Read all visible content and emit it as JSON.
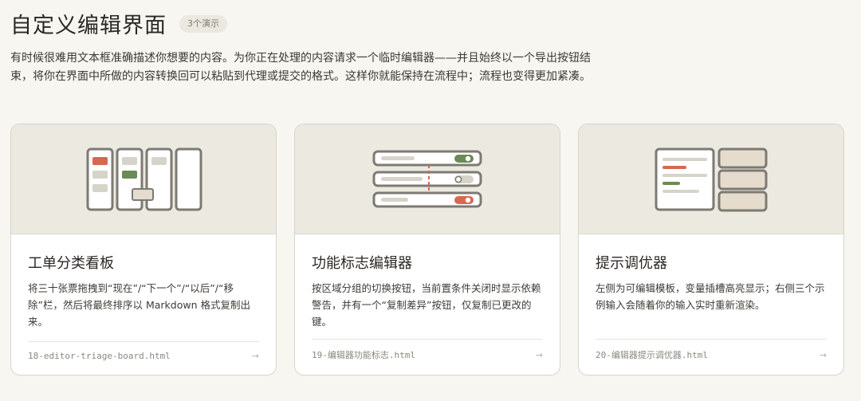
{
  "header": {
    "title": "自定义编辑界面",
    "badge": "3个演示"
  },
  "intro": "有时候很难用文本框准确描述你想要的内容。为你正在处理的内容请求一个临时编辑器——并且始终以一个导出按钮结束，将你在界面中所做的内容转换回可以粘贴到代理或提交的格式。这样你就能保持在流程中；流程也变得更加紧凑。",
  "cards": [
    {
      "title": "工单分类看板",
      "description": "将三十张票拖拽到“现在”/“下一个”/“以后”/“移除”栏，然后将最终排序以 Markdown 格式复制出来。",
      "file": "18-editor-triage-board.html",
      "arrow": "→",
      "icon": "kanban-board-icon"
    },
    {
      "title": "功能标志编辑器",
      "description": "按区域分组的切换按钮，当前置条件关闭时显示依赖警告，并有一个“复制差异”按钮，仅复制已更改的键。",
      "file": "19-编辑器功能标志.html",
      "arrow": "→",
      "icon": "toggle-list-icon"
    },
    {
      "title": "提示调优器",
      "description": "左侧为可编辑模板，变量插槽高亮显示；右侧三个示例输入会随着你的输入实时重新渲染。",
      "file": "20-编辑器提示调优器.html",
      "arrow": "→",
      "icon": "prompt-template-icon"
    }
  ],
  "colors": {
    "background": "#f8f6f1",
    "thumb": "#ebe9e0",
    "accent_red": "#d4694f",
    "accent_green": "#6b8a55",
    "outline": "#7d7a73"
  }
}
